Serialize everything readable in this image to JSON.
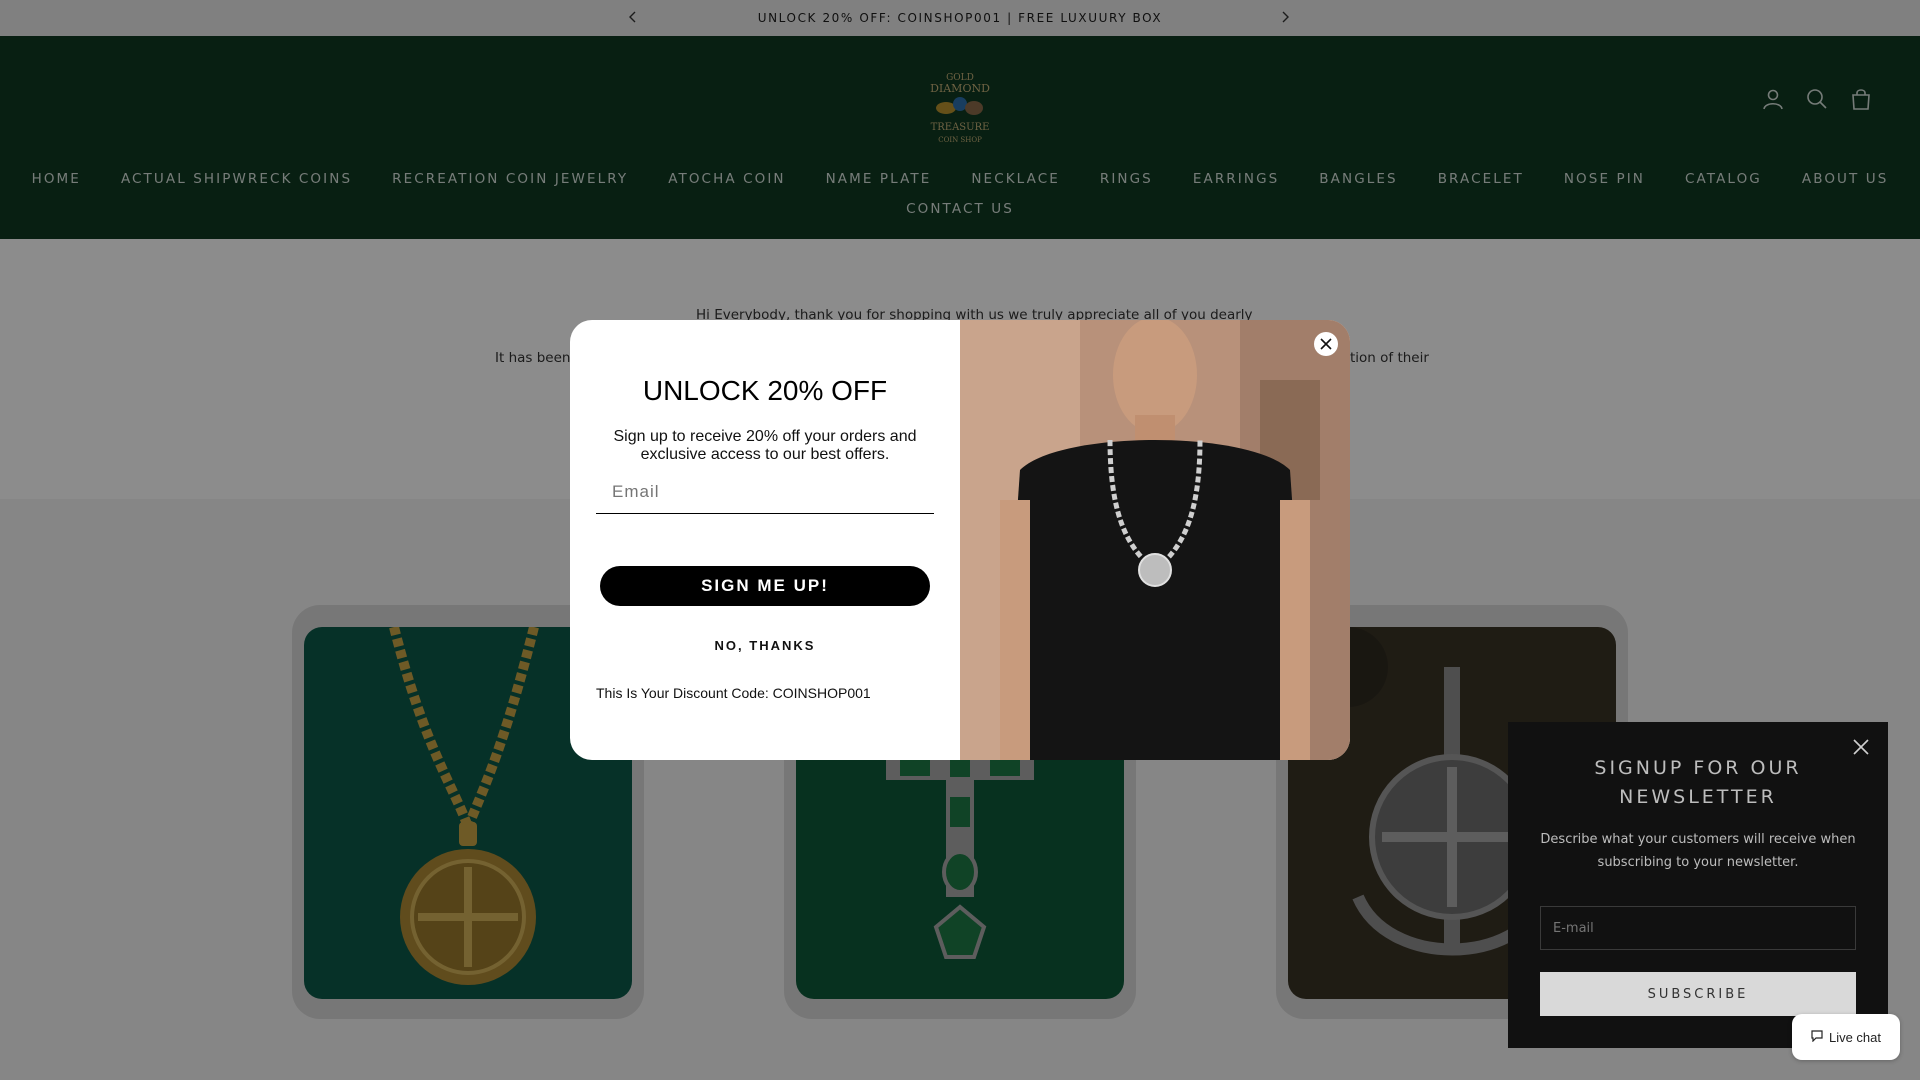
{
  "announcement": {
    "text": "UNLOCK 20% OFF: COINSHOP001 | FREE LUXUURY BOX"
  },
  "header": {
    "logo_alt": "GOLD DIAMOND TREASURE COIN SHOP",
    "logo_lines": [
      "GOLD",
      "DIAMOND",
      "TREASURE",
      "COIN SHOP"
    ],
    "icons": [
      "account-icon",
      "search-icon",
      "cart-icon"
    ]
  },
  "nav": {
    "row1": [
      "HOME",
      "ACTUAL SHIPWRECK COINS",
      "RECREATION COIN JEWELRY",
      "ATOCHA COIN",
      "NAME PLATE",
      "NECKLACE",
      "RINGS",
      "EARRINGS",
      "BANGLES",
      "BRACELET",
      "NOSE PIN",
      "CATALOG",
      "ABOUT US"
    ],
    "row2": [
      "CONTACT US"
    ]
  },
  "intro": {
    "line1": "Hi Everybody, thank you for shopping with us we truly appreciate all of you dearly",
    "line2_left": "It has been",
    "line2_right": "tion of their"
  },
  "popup": {
    "title": "UNLOCK 20% OFF",
    "subtitle": "Sign up to receive 20% off your orders and exclusive access to our best offers.",
    "email_placeholder": "Email",
    "submit_label": "SIGN ME UP!",
    "decline_label": "NO, THANKS",
    "discount_text": "This Is Your Discount Code: COINSHOP001"
  },
  "newsletter": {
    "title_line1": "SIGNUP FOR OUR",
    "title_line2": "NEWSLETTER",
    "description": "Describe what your customers will receive when subscribing to your newsletter.",
    "email_placeholder": "E-mail",
    "submit_label": "SUBSCRIBE"
  },
  "chat": {
    "label": "Live chat"
  },
  "colors": {
    "header_bg": "#0f3a22",
    "accent_black": "#000000",
    "newsletter_bg": "#111111"
  }
}
